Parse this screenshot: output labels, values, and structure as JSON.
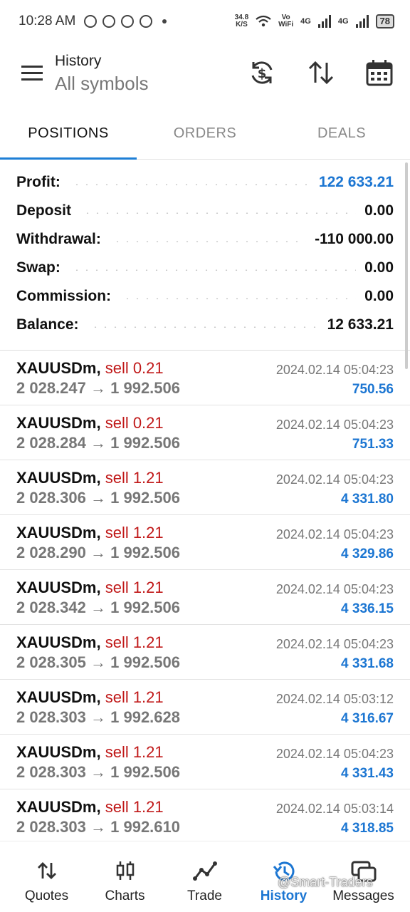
{
  "status_bar": {
    "time": "10:28 AM",
    "net_speed": "34.8",
    "net_unit": "K/S",
    "volte": "Vo",
    "wifi_label": "WiFi",
    "sim1": "4G",
    "sim2": "4G",
    "battery": "78"
  },
  "header": {
    "title": "History",
    "subtitle": "All symbols",
    "icons": [
      "currency-sync-icon",
      "sort-icon",
      "calendar-icon"
    ]
  },
  "tabs": [
    {
      "label": "POSITIONS",
      "active": true
    },
    {
      "label": "ORDERS",
      "active": false
    },
    {
      "label": "DEALS",
      "active": false
    }
  ],
  "summary": [
    {
      "label": "Profit:",
      "value": "122 633.21",
      "highlight": true
    },
    {
      "label": "Deposit",
      "value": "0.00",
      "highlight": false
    },
    {
      "label": "Withdrawal:",
      "value": "-110 000.00",
      "highlight": false
    },
    {
      "label": "Swap:",
      "value": "0.00",
      "highlight": false
    },
    {
      "label": "Commission:",
      "value": "0.00",
      "highlight": false
    },
    {
      "label": "Balance:",
      "value": "12 633.21",
      "highlight": false
    }
  ],
  "deals": [
    {
      "symbol": "XAUUSDm,",
      "side": "sell 0.21",
      "open": "2 028.247",
      "arrow": "→",
      "close": "1 992.506",
      "time": "2024.02.14 05:04:23",
      "profit": "750.56"
    },
    {
      "symbol": "XAUUSDm,",
      "side": "sell 0.21",
      "open": "2 028.284",
      "arrow": "→",
      "close": "1 992.506",
      "time": "2024.02.14 05:04:23",
      "profit": "751.33"
    },
    {
      "symbol": "XAUUSDm,",
      "side": "sell 1.21",
      "open": "2 028.306",
      "arrow": "→",
      "close": "1 992.506",
      "time": "2024.02.14 05:04:23",
      "profit": "4 331.80"
    },
    {
      "symbol": "XAUUSDm,",
      "side": "sell 1.21",
      "open": "2 028.290",
      "arrow": "→",
      "close": "1 992.506",
      "time": "2024.02.14 05:04:23",
      "profit": "4 329.86"
    },
    {
      "symbol": "XAUUSDm,",
      "side": "sell 1.21",
      "open": "2 028.342",
      "arrow": "→",
      "close": "1 992.506",
      "time": "2024.02.14 05:04:23",
      "profit": "4 336.15"
    },
    {
      "symbol": "XAUUSDm,",
      "side": "sell 1.21",
      "open": "2 028.305",
      "arrow": "→",
      "close": "1 992.506",
      "time": "2024.02.14 05:04:23",
      "profit": "4 331.68"
    },
    {
      "symbol": "XAUUSDm,",
      "side": "sell 1.21",
      "open": "2 028.303",
      "arrow": "→",
      "close": "1 992.628",
      "time": "2024.02.14 05:03:12",
      "profit": "4 316.67"
    },
    {
      "symbol": "XAUUSDm,",
      "side": "sell 1.21",
      "open": "2 028.303",
      "arrow": "→",
      "close": "1 992.506",
      "time": "2024.02.14 05:04:23",
      "profit": "4 331.43"
    },
    {
      "symbol": "XAUUSDm,",
      "side": "sell 1.21",
      "open": "2 028.303",
      "arrow": "→",
      "close": "1 992.610",
      "time": "2024.02.14 05:03:14",
      "profit": "4 318.85"
    }
  ],
  "bottom_nav": [
    {
      "label": "Quotes",
      "icon": "quotes-arrows-icon",
      "active": false
    },
    {
      "label": "Charts",
      "icon": "candlestick-icon",
      "active": false
    },
    {
      "label": "Trade",
      "icon": "trade-line-icon",
      "active": false
    },
    {
      "label": "History",
      "icon": "history-clock-icon",
      "active": true
    },
    {
      "label": "Messages",
      "icon": "messages-icon",
      "active": false
    }
  ],
  "watermark": "@Smart-Traders",
  "colors": {
    "accent": "#1c76d2",
    "sell": "#c01818",
    "muted": "#777777"
  }
}
